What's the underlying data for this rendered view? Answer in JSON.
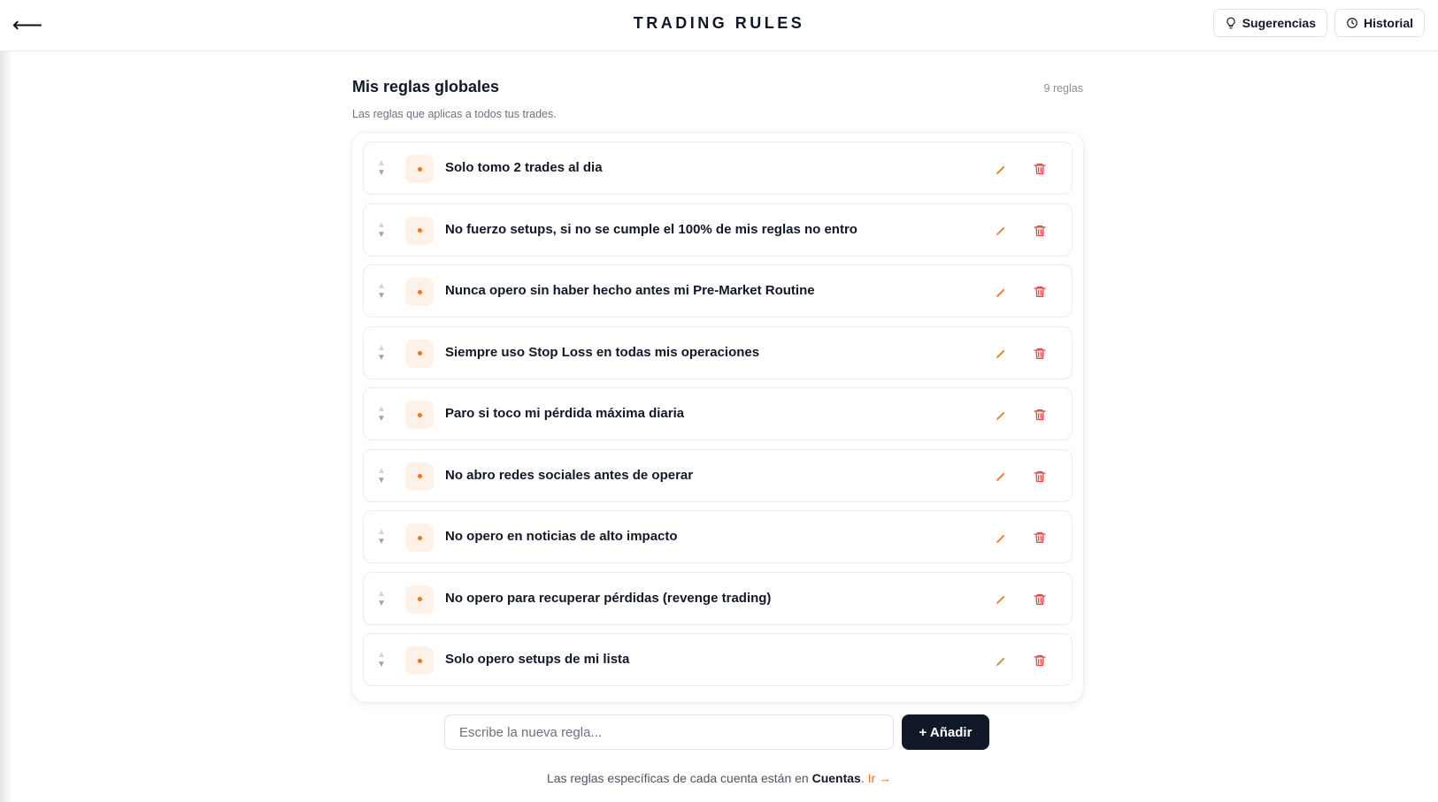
{
  "header": {
    "back_icon": "arrow-left-icon",
    "title": "TRADING RULES",
    "suggestions_label": "Sugerencias",
    "suggestions_icon": "lightbulb-icon",
    "history_label": "Historial",
    "history_icon": "clock-icon"
  },
  "section": {
    "title": "Mis reglas globales",
    "count": "9 reglas",
    "subtitle": "Las reglas que aplicas a todos tus trades."
  },
  "rules": [
    "Solo tomo 2 trades al dia",
    "No fuerzo setups, si no se cumple el 100% de mis reglas no entro",
    "Nunca opero sin haber hecho antes mi Pre-Market Routine",
    "Siempre uso Stop Loss en todas mis operaciones",
    "Paro si toco mi pérdida máxima diaria",
    "No abro redes sociales antes de operar",
    "No opero en noticias de alto impacto",
    "No opero para recuperar pérdidas (revenge trading)",
    "Solo opero setups de mi lista"
  ],
  "composer": {
    "placeholder": "Escribe la nueva regla...",
    "add_label": "+ Añadir"
  },
  "footer": {
    "text_before": "Las reglas específicas de cada cuenta están en ",
    "link_strong": "Cuentas",
    "text_after": ". ",
    "go_label": "Ir →"
  },
  "colors": {
    "accent": "#f97316",
    "delete": "#ef4444",
    "dark": "#111827"
  }
}
